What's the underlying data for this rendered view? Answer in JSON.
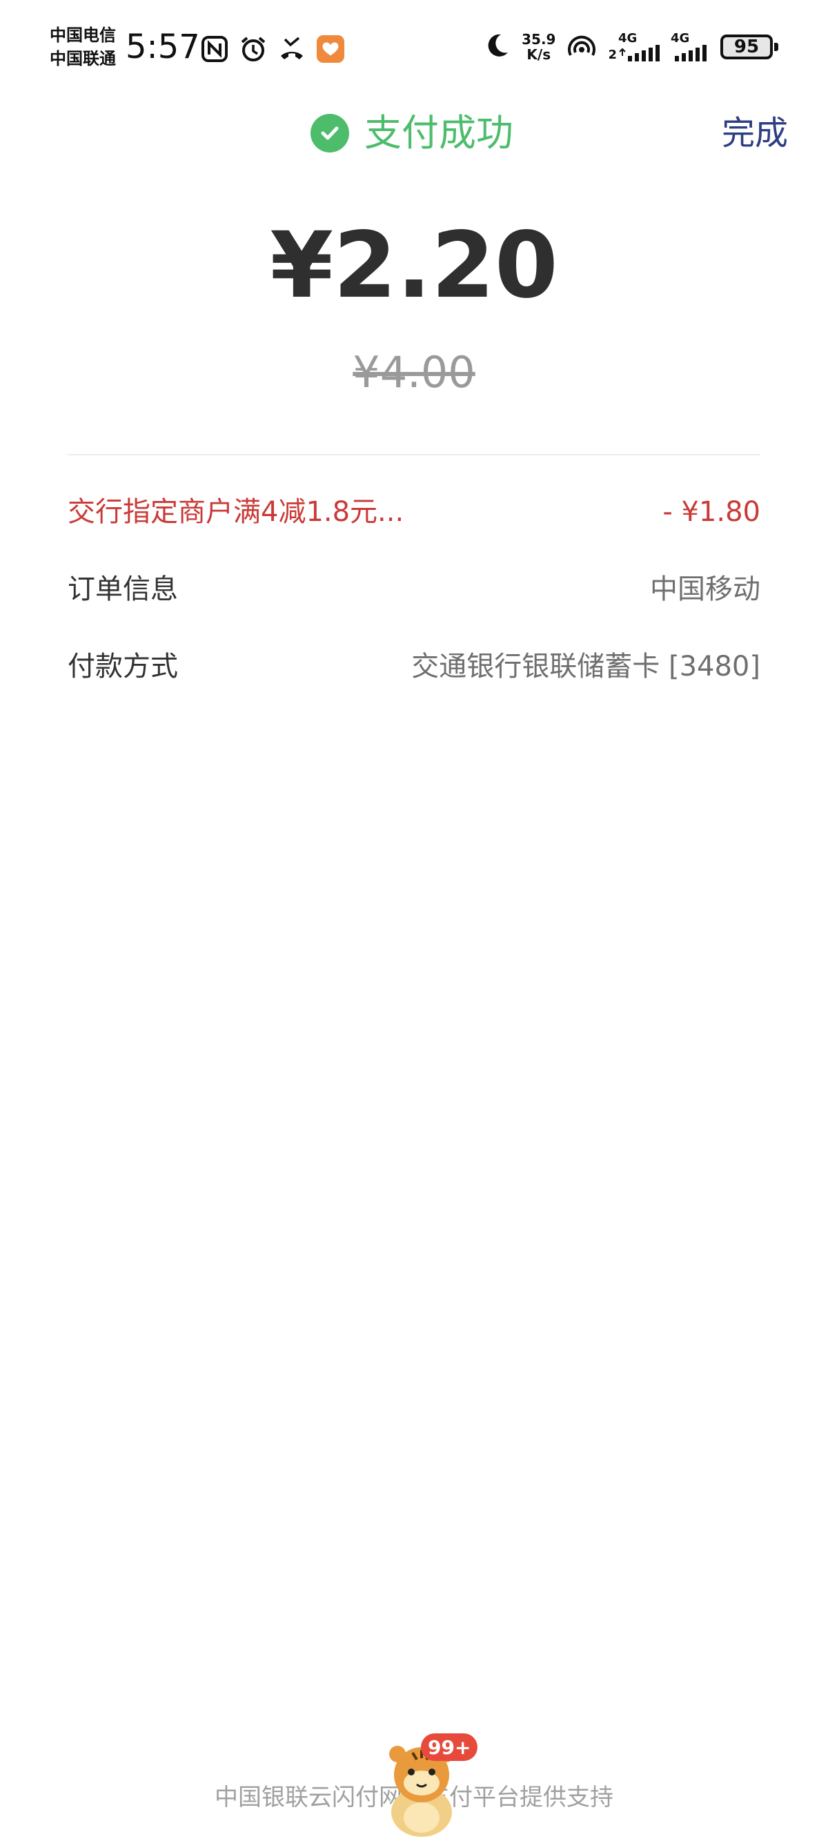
{
  "status_bar": {
    "carrier_1": "中国电信",
    "carrier_2": "中国联通",
    "time": "5:57",
    "speed_value": "35.9",
    "speed_unit": "K/s",
    "signal_1": "2",
    "network_1": "4G",
    "network_2": "4G",
    "battery": "95",
    "icons_left": [
      "nfc-icon",
      "alarm-icon",
      "missed-call-icon",
      "app-notification-icon"
    ],
    "icons_right": [
      "moon-icon",
      "hotspot-icon",
      "signal-icon",
      "signal-icon"
    ]
  },
  "header": {
    "title": "支付成功",
    "done_label": "完成",
    "accent_color": "#4dbd6c",
    "done_color": "#2d3e82"
  },
  "payment": {
    "amount": "¥2.20",
    "original_amount": "¥4.00"
  },
  "details": {
    "discount": {
      "label": "交行指定商户满4减1.8元...",
      "value": "- ¥1.80",
      "color": "#c93a37"
    },
    "order": {
      "label": "订单信息",
      "value": "中国移动"
    },
    "payment_method": {
      "label": "付款方式",
      "value": "交通银行银联储蓄卡 [3480]"
    }
  },
  "footer": {
    "text": "中国银联云闪付网络支付平台提供支持",
    "badge": "99+"
  }
}
